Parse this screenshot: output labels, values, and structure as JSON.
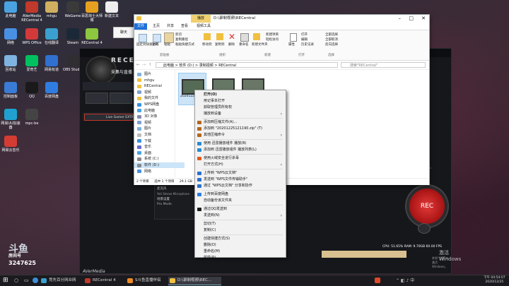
{
  "desktop_icons": [
    {
      "label": "此电脑",
      "color": "#4aa3e0"
    },
    {
      "label": "AVerMedia RECentral 4",
      "color": "#c0392b"
    },
    {
      "label": "mhgu",
      "color": "#d0b060"
    },
    {
      "label": "WeGame",
      "color": "#3a3a3a"
    },
    {
      "label": "百思淘士大师傅",
      "color": "#e6a020"
    },
    {
      "label": "新建文本",
      "color": "#eeeeee"
    },
    {
      "label": "网络",
      "color": "#4a90e2"
    },
    {
      "label": "WPS Office",
      "color": "#d23a3a"
    },
    {
      "label": "在线翻译",
      "color": "#3aa0d0"
    },
    {
      "label": "Steam",
      "color": "#1b2838"
    },
    {
      "label": "RECentral 4",
      "color": "#8dc63f"
    },
    {
      "label": "回收站",
      "color": "#7fb3e0"
    },
    {
      "label": "爱奇艺",
      "color": "#00c060"
    },
    {
      "label": "网易有道",
      "color": "#3070d0"
    },
    {
      "label": "OBS Studio",
      "color": "#302e31"
    },
    {
      "label": "控制面板",
      "color": "#3a7bd5"
    },
    {
      "label": "QQ",
      "color": "#1a1a1a"
    },
    {
      "label": "百度网盘",
      "color": "#2f7de1"
    },
    {
      "label": "网易UU加速器",
      "color": "#20a0d0"
    },
    {
      "label": "mpc-be",
      "color": "#444444"
    },
    {
      "label": "网易云音乐",
      "color": "#d43c33"
    }
  ],
  "explorer": {
    "title": "D:\\录制视频\\RECentral",
    "tab_play_label": "播放",
    "ribbon_tabs": [
      "文件",
      "主页",
      "共享",
      "查看",
      "视频工具"
    ],
    "ribbon_buttons": [
      "固定到快速访问",
      "复制",
      "粘贴",
      "剪切",
      "复制路径",
      "粘贴快捷方式",
      "移动到",
      "复制到",
      "删除",
      "重命名",
      "新建文件夹",
      "新建项目",
      "轻松访问",
      "属性",
      "打开",
      "编辑",
      "历史记录",
      "全部选择",
      "全部取消",
      "反向选择"
    ],
    "ribbon_groups": [
      "剪贴板",
      "组织",
      "新建",
      "打开",
      "选择"
    ],
    "address": [
      "此电脑",
      "软件 (D:)",
      "录制视频",
      "RECentral"
    ],
    "search_placeholder": "搜索\"RECentral\"",
    "nav_items": [
      "图片",
      "mhgu",
      "RECentral",
      "视频",
      "我的文件",
      "WPS网盘",
      "此电脑",
      "3D 对象",
      "视频",
      "图片",
      "文档",
      "下载",
      "音乐",
      "桌面",
      "系统 (C:)",
      "软件 (D:)",
      "网络"
    ],
    "files": [
      "20201225121...",
      "",
      ""
    ],
    "status_left": "2 个项目",
    "status_mid": "选中 1 个项目",
    "status_size": "29.1 GB"
  },
  "context_menu": {
    "items": [
      {
        "label": "打开(O)",
        "bold": true,
        "submenu": false
      },
      {
        "label": "用记事本打开",
        "submenu": false
      },
      {
        "label": "获取管理员所有权",
        "submenu": false
      },
      {
        "label": "播放到设备",
        "submenu": true
      },
      {
        "label": "添加到压缩文件(A)...",
        "submenu": false
      },
      {
        "label": "添加到 \"20201225121190.zip\" (T)",
        "submenu": false
      },
      {
        "label": "其他压缩命令",
        "submenu": true
      },
      {
        "label": "使用 迅雷播放组件 播放(B)",
        "submenu": false
      },
      {
        "label": "添加到 迅雷播放组件 播放列表(L)",
        "submenu": false
      },
      {
        "label": "使用火绒安全进行杀毒",
        "submenu": false
      },
      {
        "label": "打开方式(H)",
        "submenu": true
      },
      {
        "label": "上传到 \"WPS云文档\"",
        "submenu": false
      },
      {
        "label": "发送到 \"WPS文件传输助手\"",
        "submenu": false
      },
      {
        "label": "通过 \"WPS云文档\" 分享和协作",
        "submenu": false
      },
      {
        "label": "上传到百度网盘",
        "submenu": false
      },
      {
        "label": "自动备份该文件夹",
        "submenu": false
      },
      {
        "label": "通过QQ发送到",
        "submenu": false
      },
      {
        "label": "发送到(N)",
        "submenu": true
      },
      {
        "label": "剪切(T)",
        "submenu": false
      },
      {
        "label": "复制(C)",
        "submenu": false
      },
      {
        "label": "创建快捷方式(S)",
        "submenu": false
      },
      {
        "label": "删除(D)",
        "submenu": false
      },
      {
        "label": "重命名(M)",
        "submenu": false
      },
      {
        "label": "属性(R)",
        "submenu": false
      }
    ]
  },
  "recorder": {
    "brand": "RECEN",
    "logo": "AVerMedia",
    "device_tab": "采集与直播",
    "device_name": "Live Gamer EXTREME",
    "rec_button": "REC",
    "stats": "CPU: 51.65%  RAM: 9.70GB  60.00 FPS",
    "activate": "激活 Windows",
    "activate_sub": "转到\"设置\"以激活 Windows。",
    "panel_items": [
      "麦克风",
      "Yeti Stereo Microphone",
      "场景设置",
      "Pro Mode"
    ]
  },
  "sidebar_app": {
    "title": "聊天"
  },
  "watermark_lines": [
    "斗鱼",
    "房间号",
    "3247625"
  ],
  "taskbar": {
    "items": [
      {
        "label": "竞先百分网众网",
        "color": "#3aa0d0"
      },
      {
        "label": "RECentral 4",
        "color": "#c0392b"
      },
      {
        "label": "S斗鱼直播伴侣",
        "color": "#f08a24"
      },
      {
        "label": "D:\\录制视频\\REC...",
        "color": "#f0c040"
      }
    ],
    "time": "下午 04:54:07",
    "date": "2020/12/25"
  }
}
